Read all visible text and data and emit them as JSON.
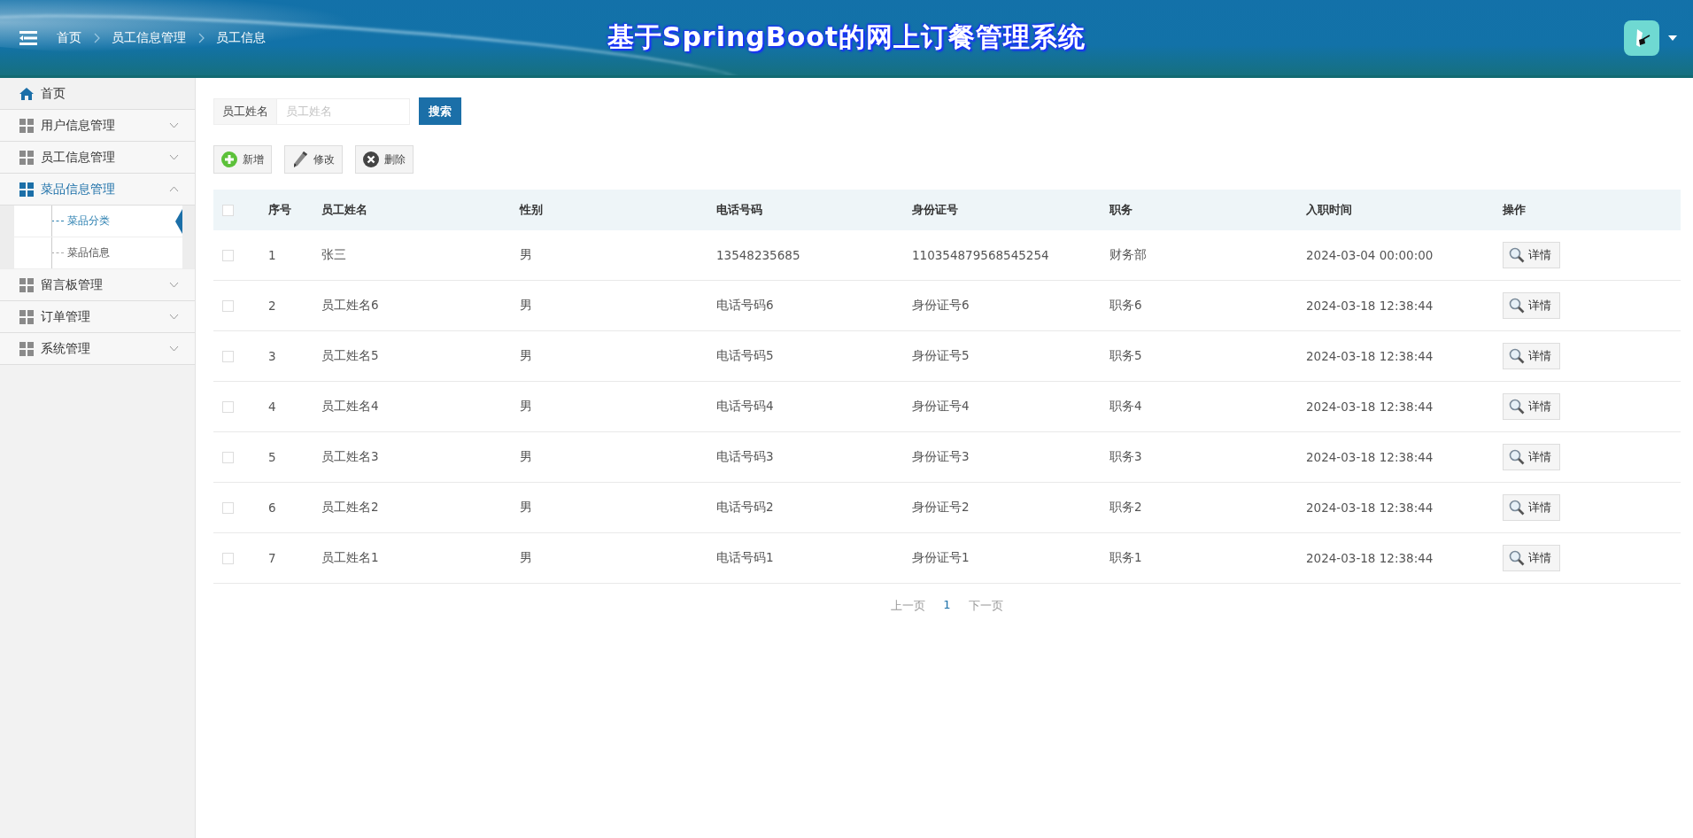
{
  "header": {
    "breadcrumbs": [
      "首页",
      "员工信息管理",
      "员工信息"
    ],
    "title": "基于SpringBoot的网上订餐管理系统"
  },
  "sidebar": {
    "items": [
      {
        "kind": "home",
        "label": "首页",
        "selected": false
      },
      {
        "kind": "group",
        "label": "用户信息管理",
        "selected": false,
        "expanded": false
      },
      {
        "kind": "group",
        "label": "员工信息管理",
        "selected": false,
        "expanded": false
      },
      {
        "kind": "group",
        "label": "菜品信息管理",
        "selected": true,
        "expanded": true,
        "children": [
          {
            "label": "菜品分类",
            "selected": true
          },
          {
            "label": "菜品信息",
            "selected": false
          }
        ]
      },
      {
        "kind": "group",
        "label": "留言板管理",
        "selected": false,
        "expanded": false
      },
      {
        "kind": "group",
        "label": "订单管理",
        "selected": false,
        "expanded": false
      },
      {
        "kind": "group",
        "label": "系统管理",
        "selected": false,
        "expanded": false
      }
    ]
  },
  "search": {
    "label": "员工姓名",
    "placeholder": "员工姓名",
    "button": "搜索"
  },
  "toolbar": [
    {
      "kind": "add",
      "label": "新增"
    },
    {
      "kind": "edit",
      "label": "修改"
    },
    {
      "kind": "delete",
      "label": "删除"
    }
  ],
  "table": {
    "all_checked": false,
    "columns": [
      "序号",
      "员工姓名",
      "性别",
      "电话号码",
      "身份证号",
      "职务",
      "入职时间",
      "操作"
    ],
    "rows": [
      {
        "checked": false,
        "cells": [
          "1",
          "张三",
          "男",
          "13548235685",
          "110354879568545254",
          "财务部",
          "2024-03-04 00:00:00"
        ],
        "action": "详情"
      },
      {
        "checked": false,
        "cells": [
          "2",
          "员工姓名6",
          "男",
          "电话号码6",
          "身份证号6",
          "职务6",
          "2024-03-18 12:38:44"
        ],
        "action": "详情"
      },
      {
        "checked": false,
        "cells": [
          "3",
          "员工姓名5",
          "男",
          "电话号码5",
          "身份证号5",
          "职务5",
          "2024-03-18 12:38:44"
        ],
        "action": "详情"
      },
      {
        "checked": false,
        "cells": [
          "4",
          "员工姓名4",
          "男",
          "电话号码4",
          "身份证号4",
          "职务4",
          "2024-03-18 12:38:44"
        ],
        "action": "详情"
      },
      {
        "checked": false,
        "cells": [
          "5",
          "员工姓名3",
          "男",
          "电话号码3",
          "身份证号3",
          "职务3",
          "2024-03-18 12:38:44"
        ],
        "action": "详情"
      },
      {
        "checked": false,
        "cells": [
          "6",
          "员工姓名2",
          "男",
          "电话号码2",
          "身份证号2",
          "职务2",
          "2024-03-18 12:38:44"
        ],
        "action": "详情"
      },
      {
        "checked": false,
        "cells": [
          "7",
          "员工姓名1",
          "男",
          "电话号码1",
          "身份证号1",
          "职务1",
          "2024-03-18 12:38:44"
        ],
        "action": "详情"
      }
    ]
  },
  "pagination": {
    "prev": "上一页",
    "pages": [
      {
        "label": "1",
        "selected": true
      }
    ],
    "next": "下一页"
  }
}
